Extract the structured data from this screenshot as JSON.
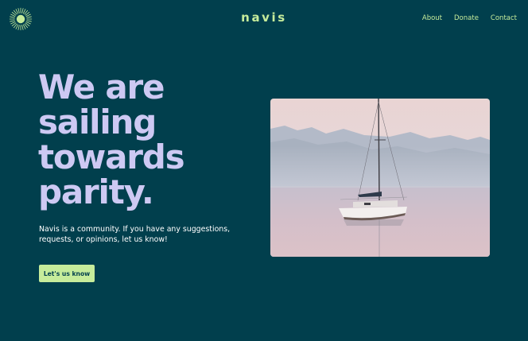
{
  "header": {
    "brand": "navis",
    "logo_icon": "sun-burst-icon",
    "nav": [
      "About",
      "Donate",
      "Contact"
    ]
  },
  "hero": {
    "headline_lines": [
      "We are",
      "sailing",
      "towards",
      "parity."
    ],
    "intro": "Navis is a community. If you have any suggestions, requests, or opinions, let us know!",
    "cta_label": "Let's us know",
    "image_subject": "sailboat-on-lake-photo"
  },
  "colors": {
    "background": "#013f4d",
    "accent": "#c6ec9b",
    "headline": "#cdc9f3",
    "body_text": "#ffffff"
  }
}
